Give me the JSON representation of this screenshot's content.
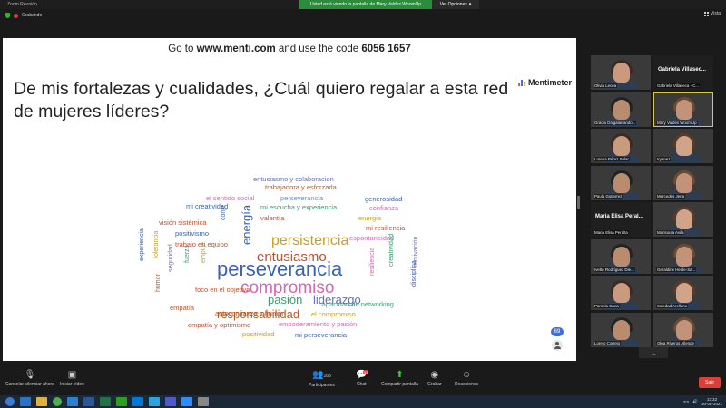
{
  "window": {
    "title": "Zoom Reunión",
    "share_banner": "Usted está viendo la pantalla de Mary Valdes WoomUp",
    "view_options": "Ver Opciones",
    "recording": "Grabando",
    "view_label": "Vista"
  },
  "slide": {
    "join_prefix": "Go to",
    "join_url": "www.menti.com",
    "join_middle": "and use the code",
    "join_code": "6056 1657",
    "question": "De mis fortalezas y cualidades, ¿Cuál quiero regalar a esta red de mujeres líderes?",
    "brand": "Mentimeter",
    "response_count": "69"
  },
  "word_cloud": [
    {
      "text": "entusiasmo y colaboracion",
      "color": "#6a6fb0",
      "size": 7.5
    },
    {
      "text": "trabajadora y esforzada",
      "color": "#b85a2a",
      "size": 7.5
    },
    {
      "text": "el sentido social",
      "color": "#d46ab0",
      "size": 7.5
    },
    {
      "text": "perseverancia",
      "color": "#6a8cd0",
      "size": 7.5
    },
    {
      "text": "generosidad",
      "color": "#3a62b8",
      "size": 7.5
    },
    {
      "text": "mi creatividad",
      "color": "#3a62b8",
      "size": 7.5
    },
    {
      "text": "conje",
      "color": "#3a62b8",
      "size": 7
    },
    {
      "text": "mi escucha y experiencia",
      "color": "#3aa070",
      "size": 7.5
    },
    {
      "text": "confianza",
      "color": "#d46ab0",
      "size": 7.5
    },
    {
      "text": "visión sistémica",
      "color": "#c05030",
      "size": 7.5
    },
    {
      "text": "energía",
      "color": "#3a62b8",
      "size": 13
    },
    {
      "text": "valentía",
      "color": "#c05030",
      "size": 7.5
    },
    {
      "text": "energia",
      "color": "#c8a020",
      "size": 7.5
    },
    {
      "text": "persistencia",
      "color": "#c8a020",
      "size": 16
    },
    {
      "text": "mi resiliencia",
      "color": "#c05030",
      "size": 7.5
    },
    {
      "text": "positivismo",
      "color": "#3a62b8",
      "size": 7.5
    },
    {
      "text": "experiencia",
      "color": "#3a62b8",
      "size": 7
    },
    {
      "text": "tolerancia",
      "color": "#c8a020",
      "size": 7
    },
    {
      "text": "trabajo en equipo",
      "color": "#c05030",
      "size": 7.5
    },
    {
      "text": "entusiasmo",
      "color": "#c05030",
      "size": 15
    },
    {
      "text": "espontaneidad",
      "color": "#d46ab0",
      "size": 7.5
    },
    {
      "text": "empuje",
      "color": "#c8a020",
      "size": 7
    },
    {
      "text": "fuerza",
      "color": "#3aa070",
      "size": 7
    },
    {
      "text": "seguridad",
      "color": "#6a6fb0",
      "size": 7
    },
    {
      "text": "perseverancia",
      "color": "#3a62b8",
      "size": 22
    },
    {
      "text": "creatividad",
      "color": "#3aa070",
      "size": 7.5
    },
    {
      "text": "motivación",
      "color": "#6a6fb0",
      "size": 7
    },
    {
      "text": "resiliencia",
      "color": "#d46ab0",
      "size": 7
    },
    {
      "text": "compromiso",
      "color": "#d46ab0",
      "size": 19
    },
    {
      "text": "humor",
      "color": "#b85a2a",
      "size": 7
    },
    {
      "text": "foco en el objetivo",
      "color": "#c05030",
      "size": 7.5
    },
    {
      "text": "pasión",
      "color": "#3aa070",
      "size": 13
    },
    {
      "text": "liderazgo",
      "color": "#6a6fb0",
      "size": 13
    },
    {
      "text": "disciplina",
      "color": "#3a62b8",
      "size": 7
    },
    {
      "text": "responsabilidad",
      "color": "#b85a2a",
      "size": 13
    },
    {
      "text": "capacidad de networking",
      "color": "#3aa070",
      "size": 7.5
    },
    {
      "text": "empatía",
      "color": "#c05030",
      "size": 7.5
    },
    {
      "text": "autoconfianza y humor",
      "color": "#b85a2a",
      "size": 7.5
    },
    {
      "text": "el compromiso",
      "color": "#c8a020",
      "size": 7.5
    },
    {
      "text": "empatía y optimismo",
      "color": "#c05030",
      "size": 7.5
    },
    {
      "text": "empoderamiento y pasión",
      "color": "#d46ab0",
      "size": 7.5
    },
    {
      "text": "positividad",
      "color": "#c8a020",
      "size": 7.5
    },
    {
      "text": "mi perseverancia",
      "color": "#3a62b8",
      "size": 7.5
    }
  ],
  "participants": [
    {
      "name": "Olivia Lecea"
    },
    {
      "name": "Gabriela Villasec...",
      "name_label": "Gabriela Villaseca - C..."
    },
    {
      "name": "Gracia Dalgalarrando..."
    },
    {
      "name": "Mary Valdes WoomUp",
      "active": true
    },
    {
      "name": "Lorena Pérez Solar"
    },
    {
      "name": "Iryanez"
    },
    {
      "name": "Paula Gutierrez"
    },
    {
      "name": "Mercedes Jeria"
    },
    {
      "name": "Maria Elisa Peral...",
      "name_label": "Maria Elisa Peralta"
    },
    {
      "name": "Marisoula Avila"
    },
    {
      "name": "Ivette Rodríguez Die..."
    },
    {
      "name": "Geraldine Heide-Sa..."
    },
    {
      "name": "Pamela Gana"
    },
    {
      "name": "Soledad Arellano"
    },
    {
      "name": "Loreto Correjo"
    },
    {
      "name": "Olga Riveros Allende"
    }
  ],
  "controls": {
    "mute": "Cancelar silenciar ahora",
    "video": "Iniciar vídeo",
    "participants": "Participantes",
    "participants_count": "163",
    "chat": "Chat",
    "chat_badge": "93",
    "share": "Compartir pantalla",
    "record": "Grabar",
    "reactions": "Reacciones",
    "exit": "Salir"
  },
  "taskbar": {
    "lang": "ES",
    "time": "13:22",
    "date": "30-08-2021"
  }
}
